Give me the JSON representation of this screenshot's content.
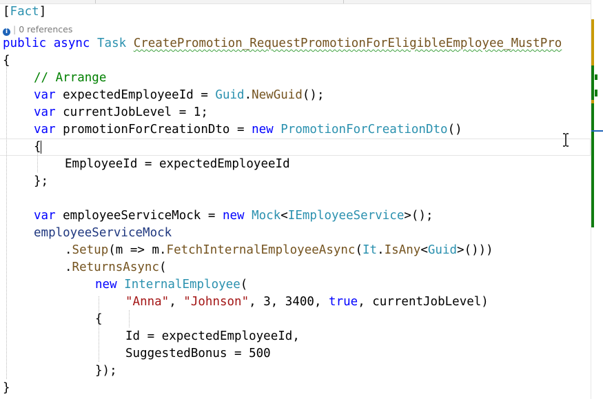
{
  "code_lens": {
    "references": "0 references"
  },
  "code": {
    "l1_attr_open": "[",
    "l1_attr_name": "Fact",
    "l1_attr_close": "]",
    "l2_public": "public",
    "l2_async": "async",
    "l2_task": "Task",
    "l2_method": "CreatePromotion_RequestPromotionForEligibleEmployee_MustPro",
    "l3": "{",
    "l4_comment": "// Arrange",
    "l5_var": "var",
    "l5_name": " expectedEmployeeId = ",
    "l5_type": "Guid",
    "l5_dot": ".",
    "l5_fn": "NewGuid",
    "l5_end": "();",
    "l6_var": "var",
    "l6_rest": " currentJobLevel = 1;",
    "l7_var": "var",
    "l7_name": " promotionForCreationDto = ",
    "l7_new": "new",
    "l7_type": "PromotionForCreationDto",
    "l7_end": "()",
    "l8": "{",
    "l9": "EmployeeId = expectedEmployeeId",
    "l10": "};",
    "l12_var": "var",
    "l12_name": " employeeServiceMock = ",
    "l12_new": "new",
    "l12_mock": "Mock",
    "l12_lt": "<",
    "l12_iface": "IEmployeeService",
    "l12_end": ">();",
    "l13": "employeeServiceMock",
    "l14_dot": ".",
    "l14_setup": "Setup",
    "l14_a": "(m => m.",
    "l14_fetch": "FetchInternalEmployeeAsync",
    "l14_b": "(",
    "l14_it": "It",
    "l14_c": ".",
    "l14_isany": "IsAny",
    "l14_d": "<",
    "l14_guid": "Guid",
    "l14_e": ">()))",
    "l15_dot": ".",
    "l15_returns": "ReturnsAsync",
    "l15_paren": "(",
    "l16_new": "new",
    "l16_type": "InternalEmployee",
    "l16_paren": "(",
    "l17_anna": "\"Anna\"",
    "l17_c1": ", ",
    "l17_johnson": "\"Johnson\"",
    "l17_nums": ", 3, 3400, ",
    "l17_true": "true",
    "l17_end": ", currentJobLevel)",
    "l18": "{",
    "l19": "Id = expectedEmployeeId,",
    "l20": "SuggestedBonus = 500",
    "l21": "});",
    "l22": "}"
  },
  "colors": {
    "keyword": "#0000ff",
    "type": "#2b91af",
    "method": "#74531f",
    "comment": "#008000",
    "string": "#a31515",
    "squiggle": "#3da13d",
    "scroll_marker_gold": "#c99a06",
    "scroll_marker_green": "#107c10",
    "scroll_marker_blue": "#1e63b8"
  }
}
